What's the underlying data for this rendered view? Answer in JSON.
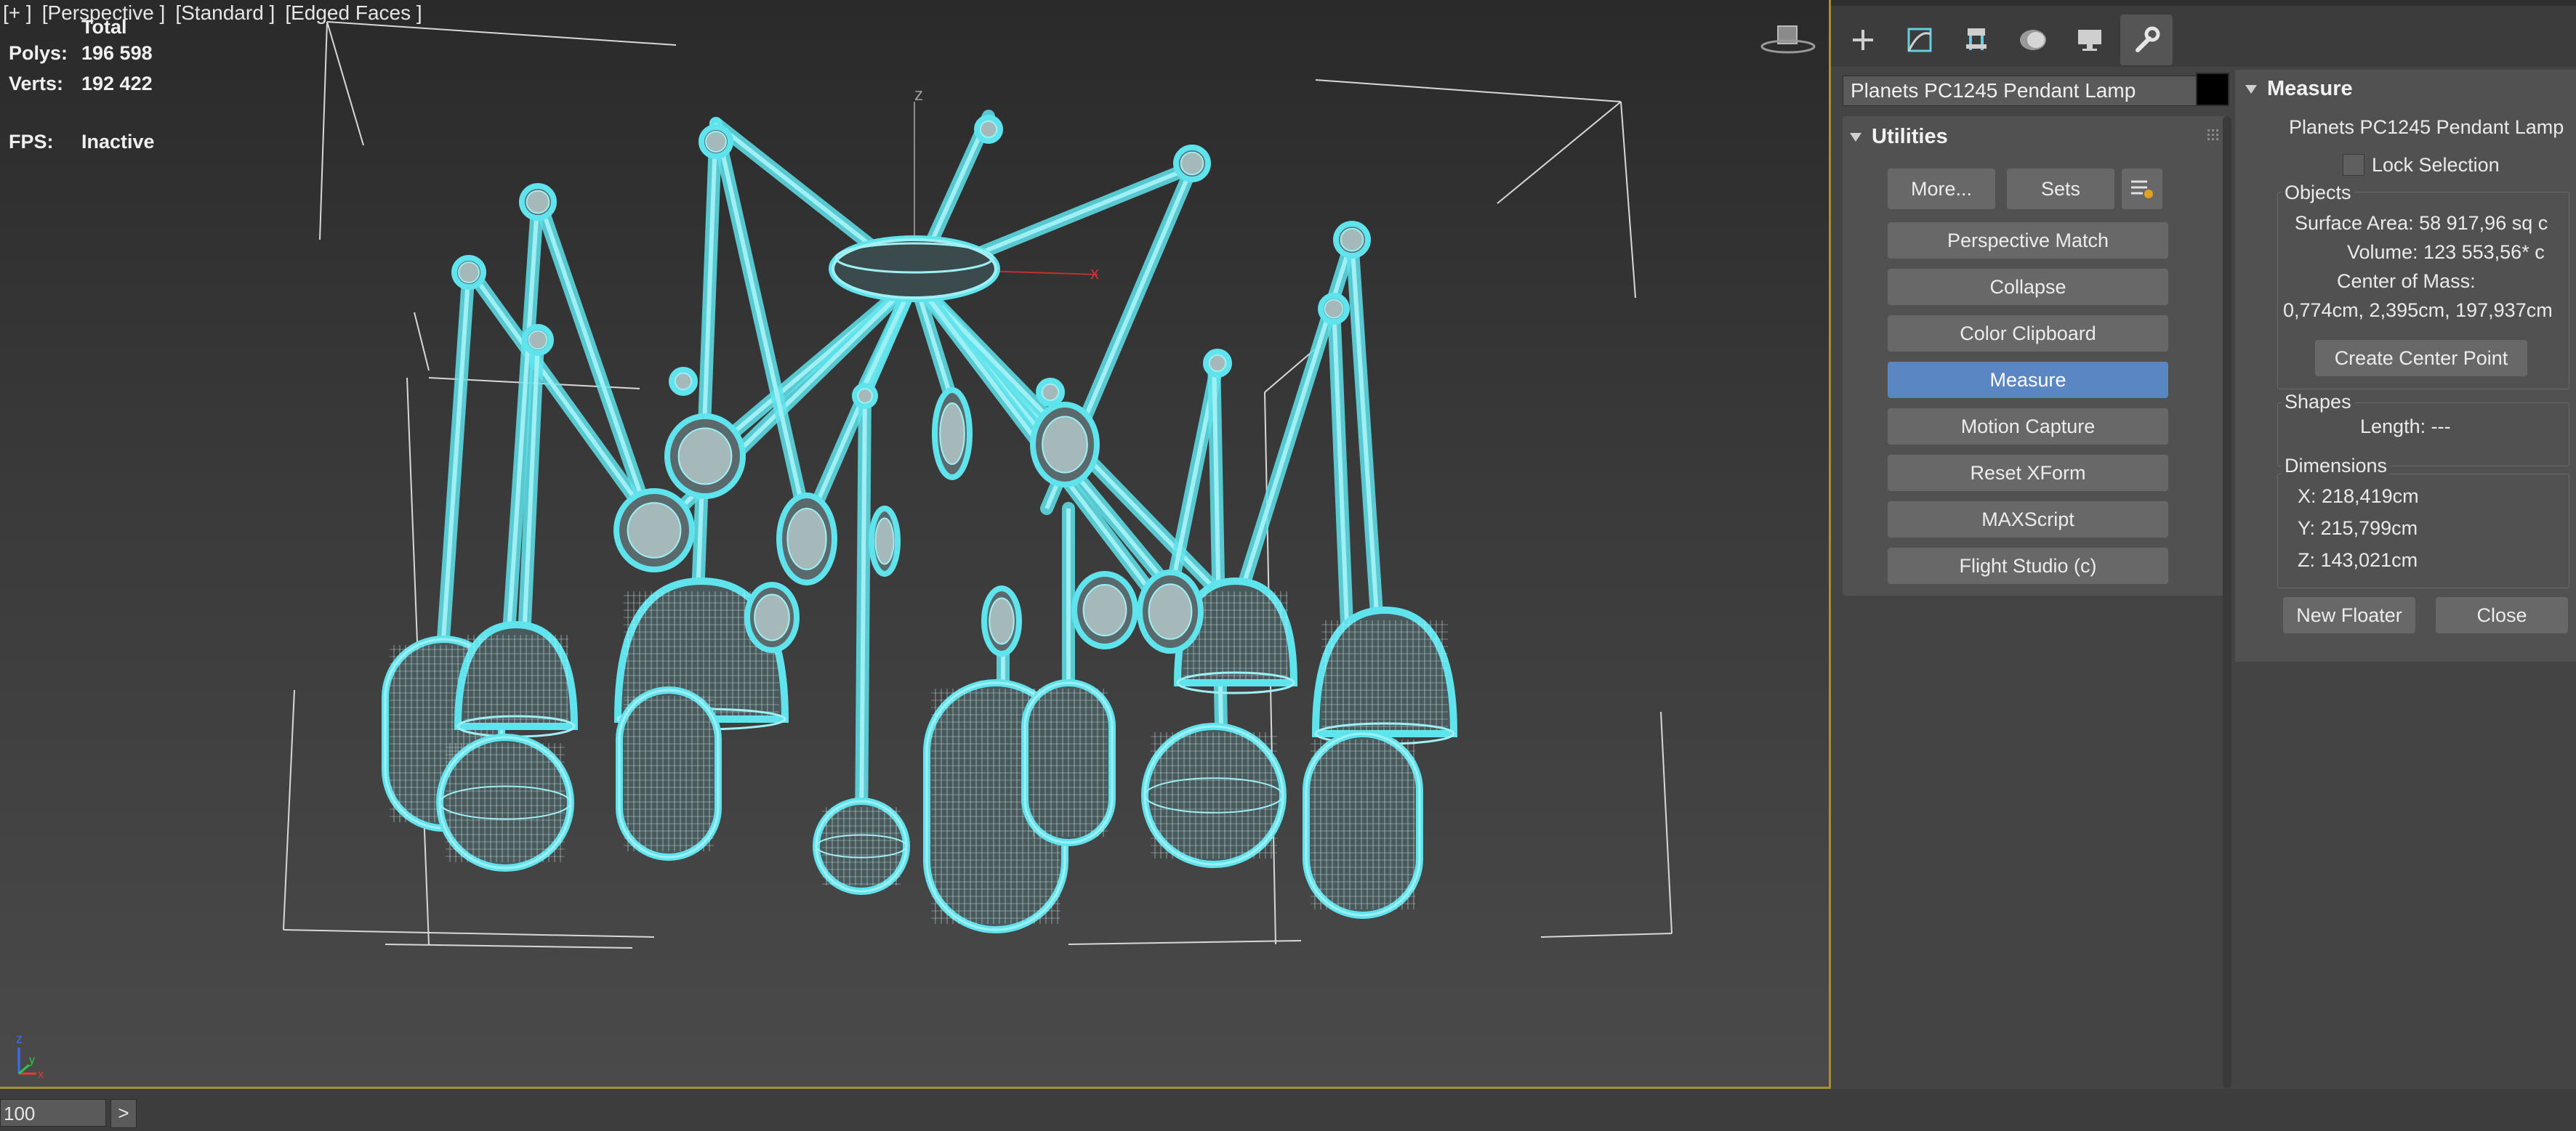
{
  "viewport": {
    "labels": [
      "[+ ]",
      "[Perspective ]",
      "[Standard ]",
      "[Edged Faces ]"
    ],
    "stats": {
      "total_label": "Total",
      "polys_label": "Polys:",
      "polys_value": "196 598",
      "verts_label": "Verts:",
      "verts_value": "192 422",
      "fps_label": "FPS:",
      "fps_value": "Inactive"
    },
    "axis_z": "z",
    "axis_x": "x",
    "tripod": {
      "x": "x",
      "y": "y",
      "z": "z"
    }
  },
  "bottom": {
    "frame_value": "100",
    "next_label": ">"
  },
  "command_panel": {
    "tabs": [
      {
        "name": "create-tab",
        "icon": "plus-icon"
      },
      {
        "name": "modify-tab",
        "icon": "modify-curve-icon"
      },
      {
        "name": "hierarchy-tab",
        "icon": "hierarchy-icon"
      },
      {
        "name": "motion-tab",
        "icon": "motion-icon"
      },
      {
        "name": "display-tab",
        "icon": "monitor-icon"
      },
      {
        "name": "utilities-tab",
        "icon": "wrench-icon"
      }
    ],
    "object_name": "Planets PC1245 Pendant Lamp",
    "object_color": "#000000",
    "utilities": {
      "title": "Utilities",
      "more_label": "More...",
      "sets_label": "Sets",
      "buttons": [
        "Perspective Match",
        "Collapse",
        "Color Clipboard",
        "Measure",
        "Motion Capture",
        "Reset XForm",
        "MAXScript",
        "Flight Studio (c)"
      ],
      "active_button": "Measure"
    },
    "measure": {
      "title": "Measure",
      "object_name": "Planets PC1245 Pendant Lamp",
      "lock_selection": "Lock Selection",
      "objects_label": "Objects",
      "surface_area": "Surface Area:  58 917,96 sq c",
      "volume": "Volume:  123 553,56* c",
      "center_of_mass_label": "Center of Mass:",
      "center_of_mass_value": "0,774cm, 2,395cm, 197,937cm",
      "create_center_point": "Create Center Point",
      "shapes_label": "Shapes",
      "length": "Length:  ---",
      "dimensions_label": "Dimensions",
      "dim_x": "X:   218,419cm",
      "dim_y": "Y:   215,799cm",
      "dim_z": "Z:   143,021cm",
      "new_floater": "New Floater",
      "close": "Close"
    }
  },
  "colors": {
    "wireframe": "#9ff0f5",
    "selection_glow": "#5fe3ec",
    "active_button": "#5b86c4",
    "viewport_border": "#a88d3a"
  }
}
